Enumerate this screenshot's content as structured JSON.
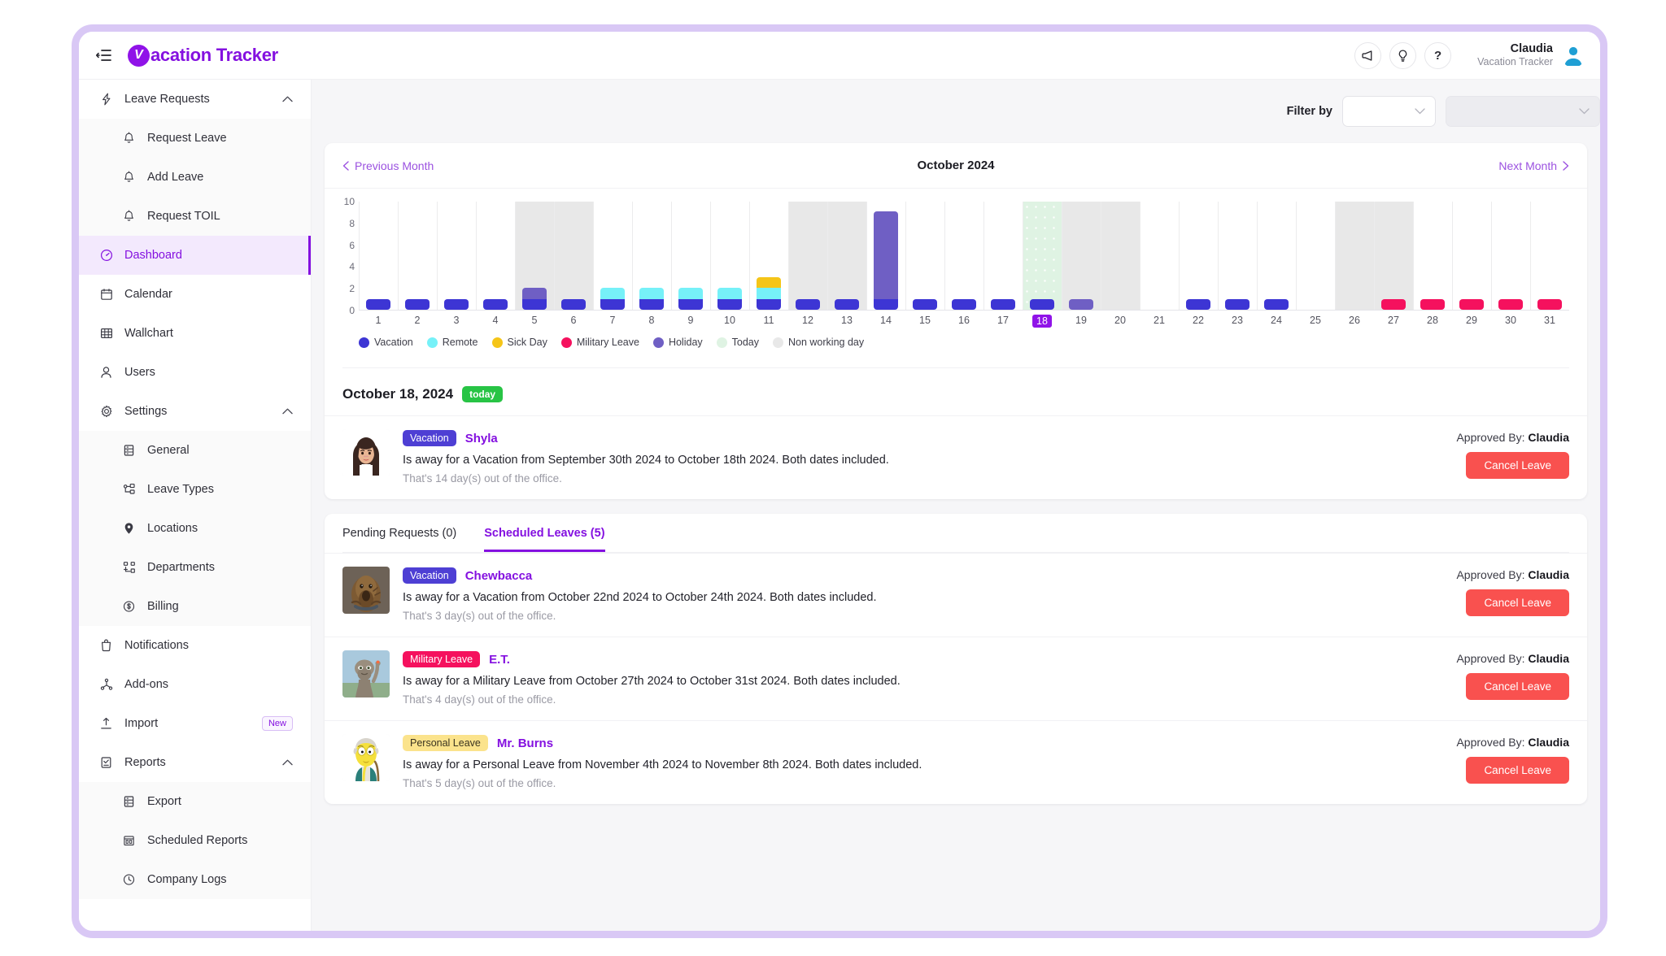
{
  "topbar": {
    "collapse_icon": "collapse-sidebar-icon",
    "brand_mark_letter": "V",
    "brand_name": "acation Tracker",
    "announce_icon": "megaphone-icon",
    "idea_icon": "lightbulb-icon",
    "help_icon": "question-mark-icon",
    "user_name": "Claudia",
    "user_org": "Vacation Tracker"
  },
  "sidebar": {
    "items": [
      {
        "label": "Leave Requests",
        "icon": "bolt-icon",
        "expandable": true,
        "expanded": true,
        "level": 0,
        "active": false
      },
      {
        "label": "Request Leave",
        "icon": "bell-icon",
        "level": 1,
        "active": false
      },
      {
        "label": "Add Leave",
        "icon": "bell-icon",
        "level": 1,
        "active": false
      },
      {
        "label": "Request TOIL",
        "icon": "bell-icon",
        "level": 1,
        "active": false
      },
      {
        "label": "Dashboard",
        "icon": "gauge-icon",
        "level": 0,
        "active": true
      },
      {
        "label": "Calendar",
        "icon": "calendar-icon",
        "level": 0,
        "active": false
      },
      {
        "label": "Wallchart",
        "icon": "grid-icon",
        "level": 0,
        "active": false
      },
      {
        "label": "Users",
        "icon": "user-icon",
        "level": 0,
        "active": false
      },
      {
        "label": "Settings",
        "icon": "gear-icon",
        "expandable": true,
        "expanded": true,
        "level": 0,
        "active": false
      },
      {
        "label": "General",
        "icon": "list-box-icon",
        "level": 1,
        "active": false
      },
      {
        "label": "Leave Types",
        "icon": "nodes-icon",
        "level": 1,
        "active": false
      },
      {
        "label": "Locations",
        "icon": "map-pin-icon",
        "level": 1,
        "active": false
      },
      {
        "label": "Departments",
        "icon": "org-chart-icon",
        "level": 1,
        "active": false
      },
      {
        "label": "Billing",
        "icon": "dollar-circle-icon",
        "level": 1,
        "active": false
      },
      {
        "label": "Notifications",
        "icon": "bell-outline-icon",
        "level": 0,
        "active": false
      },
      {
        "label": "Add-ons",
        "icon": "share-nodes-icon",
        "level": 0,
        "active": false
      },
      {
        "label": "Import",
        "icon": "upload-icon",
        "level": 0,
        "active": false,
        "badge": "New"
      },
      {
        "label": "Reports",
        "icon": "report-icon",
        "expandable": true,
        "expanded": true,
        "level": 0,
        "active": false
      },
      {
        "label": "Export",
        "icon": "list-box-icon",
        "level": 1,
        "active": false
      },
      {
        "label": "Scheduled Reports",
        "icon": "calendar-report-icon",
        "level": 1,
        "active": false
      },
      {
        "label": "Company Logs",
        "icon": "clock-icon",
        "level": 1,
        "active": false
      }
    ]
  },
  "filter": {
    "label": "Filter by",
    "select1_value": "",
    "select2_value": ""
  },
  "month_nav": {
    "prev_label": "Previous Month",
    "title": "October 2024",
    "next_label": "Next Month"
  },
  "chart_data": {
    "type": "bar",
    "title": "October 2024",
    "xlabel": "",
    "ylabel": "",
    "ylim": [
      0,
      10
    ],
    "yticks": [
      0,
      2,
      4,
      6,
      8,
      10
    ],
    "grid": true,
    "stacked": true,
    "categories": [
      "1",
      "2",
      "3",
      "4",
      "5",
      "6",
      "7",
      "8",
      "9",
      "10",
      "11",
      "12",
      "13",
      "14",
      "15",
      "16",
      "17",
      "18",
      "19",
      "20",
      "21",
      "22",
      "23",
      "24",
      "25",
      "26",
      "27",
      "28",
      "29",
      "30",
      "31"
    ],
    "series": [
      {
        "name": "Vacation",
        "color": "#3d35d4",
        "values": [
          1,
          1,
          1,
          1,
          1,
          1,
          1,
          1,
          1,
          1,
          1,
          1,
          1,
          1,
          1,
          1,
          1,
          1,
          0,
          0,
          0,
          1,
          1,
          1,
          0,
          0,
          0,
          0,
          0,
          0,
          0
        ]
      },
      {
        "name": "Remote",
        "color": "#76f1f8",
        "values": [
          0,
          0,
          0,
          0,
          0,
          0,
          1,
          1,
          1,
          1,
          1,
          0,
          0,
          0,
          0,
          0,
          0,
          0,
          0,
          0,
          0,
          0,
          0,
          0,
          0,
          0,
          0,
          0,
          0,
          0,
          0
        ]
      },
      {
        "name": "Sick Day",
        "color": "#f5c518",
        "values": [
          0,
          0,
          0,
          0,
          0,
          0,
          0,
          0,
          0,
          0,
          1,
          0,
          0,
          0,
          0,
          0,
          0,
          0,
          0,
          0,
          0,
          0,
          0,
          0,
          0,
          0,
          0,
          0,
          0,
          0,
          0
        ]
      },
      {
        "name": "Military Leave",
        "color": "#f5115e",
        "values": [
          0,
          0,
          0,
          0,
          0,
          0,
          0,
          0,
          0,
          0,
          0,
          0,
          0,
          0,
          0,
          0,
          0,
          0,
          0,
          0,
          0,
          0,
          0,
          0,
          0,
          0,
          1,
          1,
          1,
          1,
          1
        ]
      },
      {
        "name": "Holiday",
        "color": "#6f5fc4",
        "values": [
          0,
          0,
          0,
          0,
          1,
          0,
          0,
          0,
          0,
          0,
          0,
          0,
          0,
          8,
          0,
          0,
          0,
          0,
          1,
          0,
          0,
          0,
          0,
          0,
          0,
          0,
          0,
          0,
          0,
          0,
          0
        ]
      }
    ],
    "today_index": 17,
    "today_label": "18",
    "non_working_days": [
      5,
      6,
      12,
      13,
      19,
      20,
      26,
      27
    ],
    "legend": [
      {
        "label": "Vacation",
        "color": "#3d35d4"
      },
      {
        "label": "Remote",
        "color": "#76f1f8"
      },
      {
        "label": "Sick Day",
        "color": "#f5c518"
      },
      {
        "label": "Military Leave",
        "color": "#f5115e"
      },
      {
        "label": "Holiday",
        "color": "#6f5fc4"
      },
      {
        "label": "Today",
        "color": "#dff3e3"
      },
      {
        "label": "Non working day",
        "color": "#e8e8e8"
      }
    ],
    "legend_position": "bottom"
  },
  "today_section": {
    "date": "October 18, 2024",
    "pill": "today",
    "entries": [
      {
        "type": "Vacation",
        "type_color": "#4e3fd4",
        "type_text_color": "#ffffff",
        "name": "Shyla",
        "avatar": "woman-long-dark-hair-avatar",
        "description": "Is away for a Vacation from September 30th 2024 to October 18th 2024. Both dates included.",
        "sub": "That's 14 day(s) out of the office.",
        "approved_prefix": "Approved By:",
        "approved_by": "Claudia",
        "cancel_label": "Cancel Leave"
      }
    ]
  },
  "tabs": [
    {
      "label": "Pending Requests (0)",
      "active": false
    },
    {
      "label": "Scheduled Leaves (5)",
      "active": true
    }
  ],
  "scheduled_leaves": [
    {
      "type": "Vacation",
      "type_color": "#4e3fd4",
      "type_text_color": "#ffffff",
      "name": "Chewbacca",
      "avatar": "chewbacca-avatar",
      "description": "Is away for a Vacation from October 22nd 2024 to October 24th 2024. Both dates included.",
      "sub": "That's 3 day(s) out of the office.",
      "approved_prefix": "Approved By:",
      "approved_by": "Claudia",
      "cancel_label": "Cancel Leave"
    },
    {
      "type": "Military Leave",
      "type_color": "#f5115e",
      "type_text_color": "#ffffff",
      "name": "E.T.",
      "avatar": "et-avatar",
      "description": "Is away for a Military Leave from October 27th 2024 to October 31st 2024. Both dates included.",
      "sub": "That's 4 day(s) out of the office.",
      "approved_prefix": "Approved By:",
      "approved_by": "Claudia",
      "cancel_label": "Cancel Leave"
    },
    {
      "type": "Personal Leave",
      "type_color": "#fbe38c",
      "type_text_color": "#3a3320",
      "name": "Mr. Burns",
      "avatar": "mr-burns-avatar",
      "description": "Is away for a Personal Leave from November 4th 2024 to November 8th 2024. Both dates included.",
      "sub": "That's 5 day(s) out of the office.",
      "approved_prefix": "Approved By:",
      "approved_by": "Claudia",
      "cancel_label": "Cancel Leave"
    }
  ]
}
